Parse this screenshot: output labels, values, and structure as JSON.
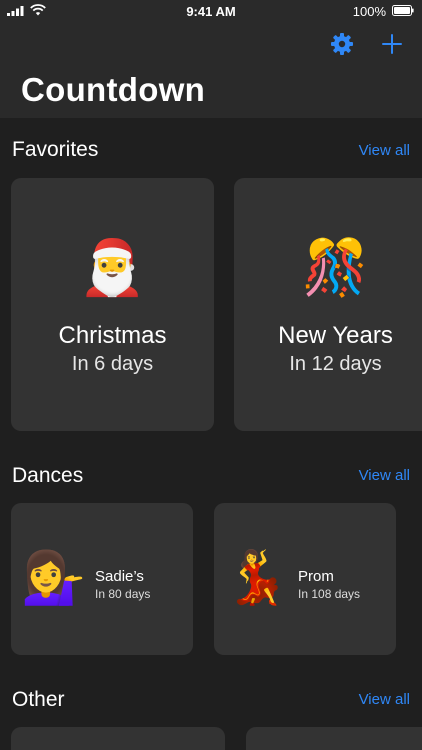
{
  "status": {
    "time": "9:41 AM",
    "battery": "100%"
  },
  "header": {
    "title": "Countdown"
  },
  "colors": {
    "accent": "#2f87f6",
    "card": "#333333",
    "background": "#1f1f1f"
  },
  "icons": {
    "settings": "gear-icon",
    "add": "plus-icon"
  },
  "sections": {
    "favorites": {
      "title": "Favorites",
      "view_all": "View all",
      "items": [
        {
          "emoji": "🎅",
          "name": "Christmas",
          "subtitle": "In 6 days"
        },
        {
          "emoji": "🎊",
          "name": "New Years",
          "subtitle": "In 12 days"
        }
      ]
    },
    "dances": {
      "title": "Dances",
      "view_all": "View all",
      "items": [
        {
          "emoji": "💁‍♀️",
          "name": "Sadie’s",
          "subtitle": "In 80 days"
        },
        {
          "emoji": "💃",
          "name": "Prom",
          "subtitle": "In 108 days"
        }
      ]
    },
    "other": {
      "title": "Other",
      "view_all": "View all"
    }
  }
}
